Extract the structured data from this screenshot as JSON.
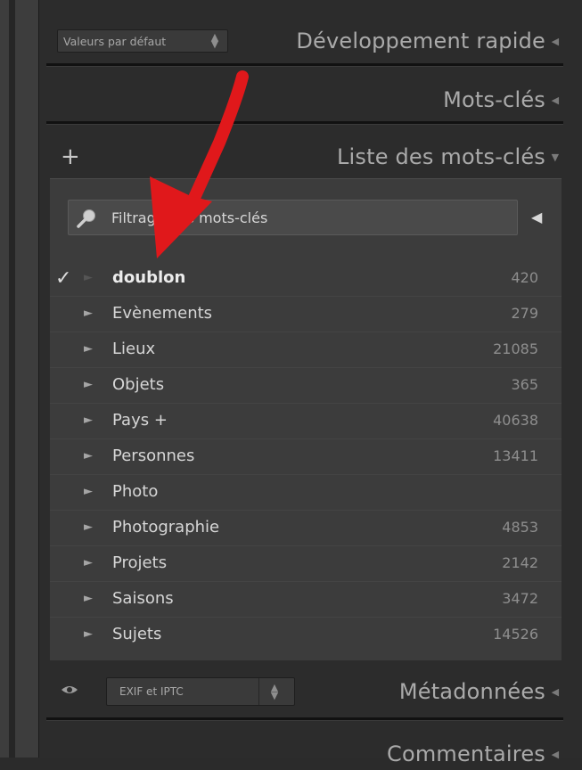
{
  "panels": {
    "quick_develop": {
      "preset_value": "Valeurs par défaut",
      "title": "Développement rapide"
    },
    "keywording": {
      "title": "Mots-clés"
    },
    "keyword_list": {
      "title": "Liste des mots-clés",
      "filter_value": "Filtrage des mots-clés",
      "items": [
        {
          "name": "doublon",
          "count": "420",
          "checked": true
        },
        {
          "name": "Evènements",
          "count": "279"
        },
        {
          "name": "Lieux",
          "count": "21085"
        },
        {
          "name": "Objets",
          "count": "365"
        },
        {
          "name": "Pays +",
          "count": "40638"
        },
        {
          "name": "Personnes",
          "count": "13411"
        },
        {
          "name": "Photo",
          "count": ""
        },
        {
          "name": "Photographie",
          "count": "4853"
        },
        {
          "name": "Projets",
          "count": "2142"
        },
        {
          "name": "Saisons",
          "count": "3472"
        },
        {
          "name": "Sujets",
          "count": "14526"
        }
      ]
    },
    "metadata": {
      "preset_value": "EXIF et IPTC",
      "title": "Métadonnées"
    },
    "comments": {
      "title": "Commentaires"
    }
  },
  "glyphs": {
    "plus": "+",
    "check": "✓",
    "expand_arrow": "►",
    "stepper": "⬍",
    "filter_toggle": "◀"
  },
  "colors": {
    "panel_bg": "#2c2c2c",
    "list_bg": "#3c3c3c",
    "annotation_arrow": "#e0181b"
  }
}
